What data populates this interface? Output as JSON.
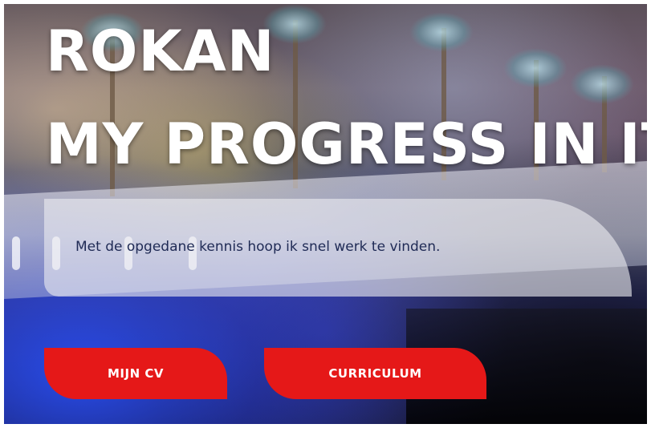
{
  "hero": {
    "title_line1": "ROKAN",
    "title_line2": "MY PROGRESS IN IT",
    "description": "Met de opgedane kennis hoop ik snel werk te vinden."
  },
  "buttons": {
    "cv_label": "MIJN CV",
    "curriculum_label": "CURRICULUM"
  },
  "colors": {
    "button_bg": "#e51818",
    "title_text": "#ffffff",
    "description_text": "#1f2a55"
  }
}
